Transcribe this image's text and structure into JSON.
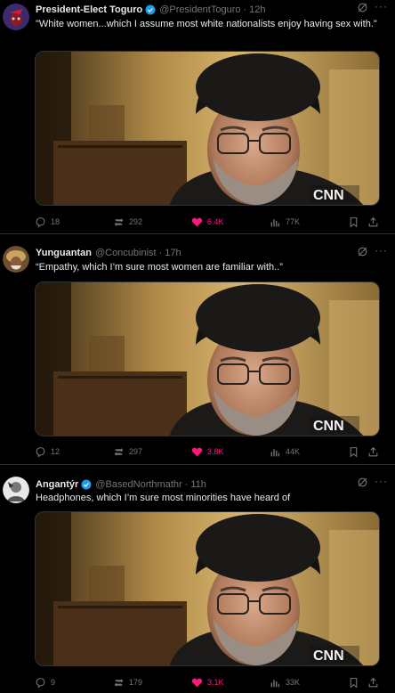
{
  "tweets": [
    {
      "author": "President-Elect Toguro",
      "handle": "@PresidentToguro",
      "time": "12h",
      "verified": true,
      "text": "\"White women...which I assume most white nationalists enjoy having sex with.\"",
      "stats": {
        "replies": "18",
        "reposts": "292",
        "likes": "6.4K",
        "views": "77K"
      },
      "media_watermark": "CNN"
    },
    {
      "author": "Yunguantan",
      "handle": "@Concubinist",
      "time": "17h",
      "verified": false,
      "text": "“Empathy, which I’m sure most women are familiar with..”",
      "stats": {
        "replies": "12",
        "reposts": "297",
        "likes": "3.8K",
        "views": "44K"
      },
      "media_watermark": "CNN"
    },
    {
      "author": "Angantýr",
      "handle": "@BasedNorthmathr",
      "time": "11h",
      "verified": true,
      "text": "Headphones, which I’m sure most minorities have heard of",
      "stats": {
        "replies": "9",
        "reposts": "179",
        "likes": "3.1K",
        "views": "33K"
      },
      "media_watermark": "CNN"
    }
  ],
  "colors": {
    "background": "#000000",
    "text": "#e7e9ea",
    "secondary": "#71767b",
    "like": "#f91880",
    "verified": "#1d9bf0",
    "divider": "#2f3336"
  },
  "icons": [
    "reply-icon",
    "repost-icon",
    "like-icon",
    "views-icon",
    "bookmark-icon",
    "share-icon",
    "grok-icon",
    "more-icon",
    "verified-icon"
  ]
}
